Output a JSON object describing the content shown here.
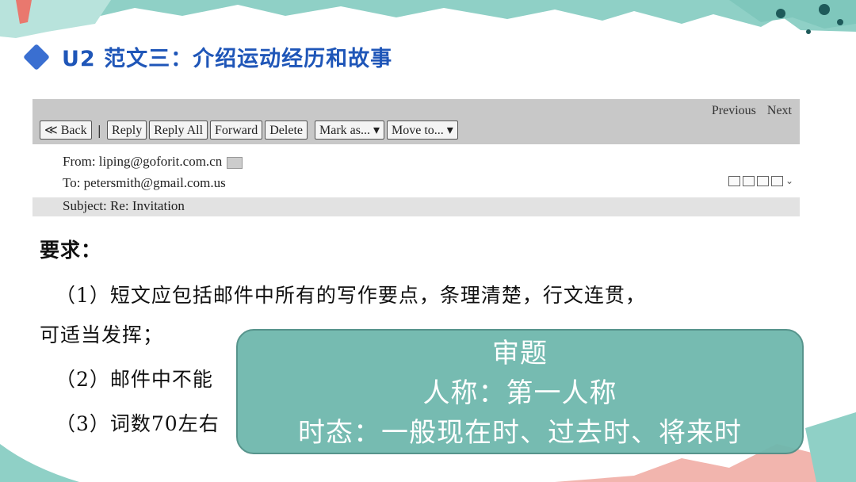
{
  "slide": {
    "title": "U2 范文三：介绍运动经历和故事"
  },
  "email": {
    "nav": {
      "previous": "Previous",
      "next": "Next"
    },
    "toolbar": {
      "back": "≪ Back",
      "separator": "|",
      "reply": "Reply",
      "reply_all": "Reply All",
      "forward": "Forward",
      "delete": "Delete",
      "mark_as": "Mark as... ▾",
      "move_to": "Move to... ▾"
    },
    "from": "From: liping@goforit.com.cn",
    "to": "To: petersmith@gmail.com.us",
    "subject": "Subject: Re: Invitation"
  },
  "requirements": {
    "heading": "要求：",
    "item1_line1": "（1）短文应包括邮件中所有的写作要点，条理清楚，行文连贯，",
    "item1_line2": "可适当发挥；",
    "item2": "（2）邮件中不能",
    "item3": "（3）词数70左右"
  },
  "overlay": {
    "line1": "审题",
    "line2": "人称：第一人称",
    "line3": "时态：一般现在时、过去时、将来时"
  },
  "colors": {
    "title_blue": "#1f56b8",
    "overlay_teal": "#6fb8ad",
    "decor_teal": "#8fd0c6",
    "decor_pink": "#f2b5ae"
  }
}
